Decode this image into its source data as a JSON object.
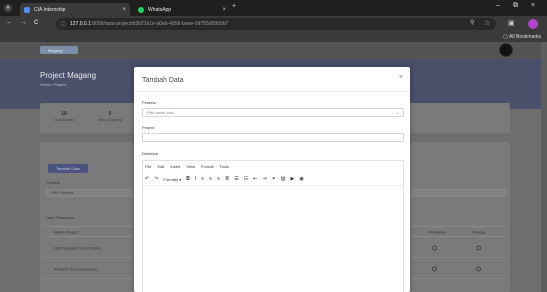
{
  "browser": {
    "tabs": [
      {
        "title": "CIA Internship",
        "close": "×",
        "favicon_color": "#4f8ef7"
      },
      {
        "title": "WhatsApp",
        "close": "×",
        "favicon_color": "#25d366"
      }
    ],
    "new_tab": "+",
    "window_controls": [
      "–",
      "⧉",
      "×"
    ],
    "nav": {
      "back": "←",
      "forward": "→",
      "reload": "C"
    },
    "address": {
      "host": "127.0.0.1",
      "path": ":8000/data-project/d3b21b1e-a0eb-4956-beee-0d755d58b5b7"
    },
    "toolbar_icons": [
      "search-icon",
      "star-icon",
      "extensions-icon"
    ],
    "bookmarks_all": "All Bookmarks"
  },
  "app": {
    "brand": "Magang",
    "page_title": "Project Magang",
    "breadcrumb": "Home  /  Project",
    "stats": [
      {
        "value": "18",
        "label": "Dashboard"
      },
      {
        "value": "0",
        "label": "Mitra Magang"
      }
    ],
    "add_button": "Tambah Data",
    "filter_label": "Peserta",
    "filter_value": "Pilih Peserta",
    "table_label": "Hasil Pekerjaan",
    "table_headers": [
      "Nama Project",
      "Perbaikan",
      "Selesai"
    ],
    "rows": [
      {
        "name": "Optimalisasi Proses Bisnis"
      },
      {
        "name": "Analisis Tren Konsumen"
      }
    ]
  },
  "modal": {
    "title": "Tambah Data",
    "close": "×",
    "field_peserta_label": "Peserta",
    "field_peserta_placeholder": "Pilih salah satu",
    "field_project_label": "Project",
    "field_deskripsi_label": "Deskripsi",
    "editor_menu": [
      "File",
      "Edit",
      "Insert",
      "View",
      "Format",
      "Tools"
    ],
    "editor_format_label": "Formats",
    "editor_tools": [
      "undo-icon",
      "redo-icon",
      "bold-icon",
      "italic-icon",
      "align-left-icon",
      "align-center-icon",
      "align-right-icon",
      "justify-icon",
      "bullet-list-icon",
      "numbered-list-icon",
      "outdent-icon",
      "indent-icon",
      "link-icon",
      "image-icon",
      "media-icon",
      "preview-icon"
    ]
  },
  "colors": {
    "modal_bg": "#ffffff",
    "overlay": "#6e6e6e",
    "header_band": "#4a4f6a",
    "accent": "#4a5280",
    "profile": "#b044c8"
  }
}
